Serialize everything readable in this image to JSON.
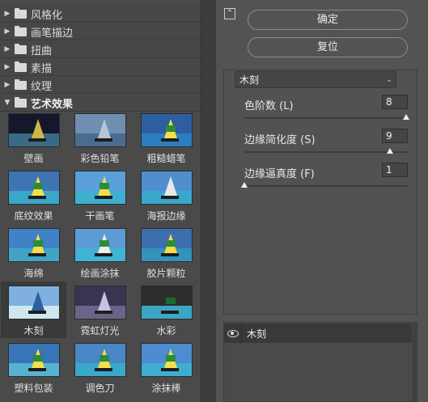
{
  "gallery": {
    "folders": [
      {
        "label": "风格化",
        "open": false
      },
      {
        "label": "画笔描边",
        "open": false
      },
      {
        "label": "扭曲",
        "open": false
      },
      {
        "label": "素描",
        "open": false
      },
      {
        "label": "纹理",
        "open": false
      },
      {
        "label": "艺术效果",
        "open": true
      }
    ],
    "thumbnails": [
      {
        "label": "壁画",
        "selected": false
      },
      {
        "label": "彩色铅笔",
        "selected": false
      },
      {
        "label": "粗糙蜡笔",
        "selected": false
      },
      {
        "label": "底纹效果",
        "selected": false
      },
      {
        "label": "干画笔",
        "selected": false
      },
      {
        "label": "海报边缘",
        "selected": false
      },
      {
        "label": "海绵",
        "selected": false
      },
      {
        "label": "绘画涂抹",
        "selected": false
      },
      {
        "label": "胶片颗粒",
        "selected": false
      },
      {
        "label": "木刻",
        "selected": true
      },
      {
        "label": "霓虹灯光",
        "selected": false
      },
      {
        "label": "水彩",
        "selected": false
      },
      {
        "label": "塑料包装",
        "selected": false
      },
      {
        "label": "调色刀",
        "selected": false
      },
      {
        "label": "涂抹棒",
        "selected": false
      }
    ]
  },
  "buttons": {
    "collapse_icon": "chevrons-up-icon",
    "ok_label": "确定",
    "reset_label": "复位"
  },
  "filter": {
    "selected": "木刻",
    "params": [
      {
        "label": "色阶数 (L)",
        "value": "8",
        "level": 1.0
      },
      {
        "label": "边缘简化度 (S)",
        "value": "9",
        "level": 0.9
      },
      {
        "label": "边缘逼真度 (F)",
        "value": "1",
        "level": 0.0
      }
    ]
  },
  "layers": {
    "items": [
      {
        "label": "木刻",
        "visible": true
      }
    ]
  },
  "colors": {
    "panel_bg": "#535353",
    "gallery_bg": "#4a4a4a",
    "selected_bg": "#3a3a3a",
    "text": "#e6e6e6"
  }
}
